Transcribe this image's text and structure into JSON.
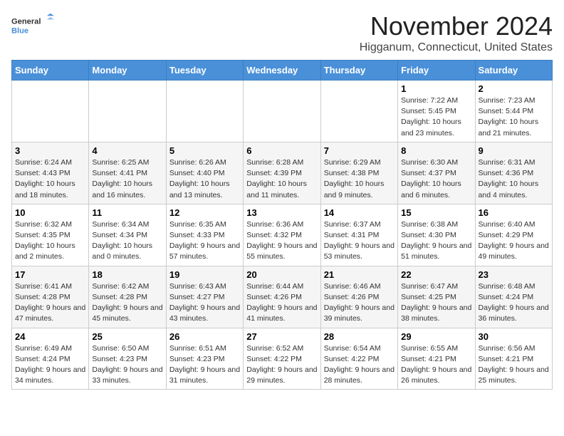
{
  "logo": {
    "line1": "General",
    "line2": "Blue"
  },
  "title": "November 2024",
  "location": "Higganum, Connecticut, United States",
  "weekdays": [
    "Sunday",
    "Monday",
    "Tuesday",
    "Wednesday",
    "Thursday",
    "Friday",
    "Saturday"
  ],
  "weeks": [
    [
      {
        "day": "",
        "info": ""
      },
      {
        "day": "",
        "info": ""
      },
      {
        "day": "",
        "info": ""
      },
      {
        "day": "",
        "info": ""
      },
      {
        "day": "",
        "info": ""
      },
      {
        "day": "1",
        "info": "Sunrise: 7:22 AM\nSunset: 5:45 PM\nDaylight: 10 hours and 23 minutes."
      },
      {
        "day": "2",
        "info": "Sunrise: 7:23 AM\nSunset: 5:44 PM\nDaylight: 10 hours and 21 minutes."
      }
    ],
    [
      {
        "day": "3",
        "info": "Sunrise: 6:24 AM\nSunset: 4:43 PM\nDaylight: 10 hours and 18 minutes."
      },
      {
        "day": "4",
        "info": "Sunrise: 6:25 AM\nSunset: 4:41 PM\nDaylight: 10 hours and 16 minutes."
      },
      {
        "day": "5",
        "info": "Sunrise: 6:26 AM\nSunset: 4:40 PM\nDaylight: 10 hours and 13 minutes."
      },
      {
        "day": "6",
        "info": "Sunrise: 6:28 AM\nSunset: 4:39 PM\nDaylight: 10 hours and 11 minutes."
      },
      {
        "day": "7",
        "info": "Sunrise: 6:29 AM\nSunset: 4:38 PM\nDaylight: 10 hours and 9 minutes."
      },
      {
        "day": "8",
        "info": "Sunrise: 6:30 AM\nSunset: 4:37 PM\nDaylight: 10 hours and 6 minutes."
      },
      {
        "day": "9",
        "info": "Sunrise: 6:31 AM\nSunset: 4:36 PM\nDaylight: 10 hours and 4 minutes."
      }
    ],
    [
      {
        "day": "10",
        "info": "Sunrise: 6:32 AM\nSunset: 4:35 PM\nDaylight: 10 hours and 2 minutes."
      },
      {
        "day": "11",
        "info": "Sunrise: 6:34 AM\nSunset: 4:34 PM\nDaylight: 10 hours and 0 minutes."
      },
      {
        "day": "12",
        "info": "Sunrise: 6:35 AM\nSunset: 4:33 PM\nDaylight: 9 hours and 57 minutes."
      },
      {
        "day": "13",
        "info": "Sunrise: 6:36 AM\nSunset: 4:32 PM\nDaylight: 9 hours and 55 minutes."
      },
      {
        "day": "14",
        "info": "Sunrise: 6:37 AM\nSunset: 4:31 PM\nDaylight: 9 hours and 53 minutes."
      },
      {
        "day": "15",
        "info": "Sunrise: 6:38 AM\nSunset: 4:30 PM\nDaylight: 9 hours and 51 minutes."
      },
      {
        "day": "16",
        "info": "Sunrise: 6:40 AM\nSunset: 4:29 PM\nDaylight: 9 hours and 49 minutes."
      }
    ],
    [
      {
        "day": "17",
        "info": "Sunrise: 6:41 AM\nSunset: 4:28 PM\nDaylight: 9 hours and 47 minutes."
      },
      {
        "day": "18",
        "info": "Sunrise: 6:42 AM\nSunset: 4:28 PM\nDaylight: 9 hours and 45 minutes."
      },
      {
        "day": "19",
        "info": "Sunrise: 6:43 AM\nSunset: 4:27 PM\nDaylight: 9 hours and 43 minutes."
      },
      {
        "day": "20",
        "info": "Sunrise: 6:44 AM\nSunset: 4:26 PM\nDaylight: 9 hours and 41 minutes."
      },
      {
        "day": "21",
        "info": "Sunrise: 6:46 AM\nSunset: 4:26 PM\nDaylight: 9 hours and 39 minutes."
      },
      {
        "day": "22",
        "info": "Sunrise: 6:47 AM\nSunset: 4:25 PM\nDaylight: 9 hours and 38 minutes."
      },
      {
        "day": "23",
        "info": "Sunrise: 6:48 AM\nSunset: 4:24 PM\nDaylight: 9 hours and 36 minutes."
      }
    ],
    [
      {
        "day": "24",
        "info": "Sunrise: 6:49 AM\nSunset: 4:24 PM\nDaylight: 9 hours and 34 minutes."
      },
      {
        "day": "25",
        "info": "Sunrise: 6:50 AM\nSunset: 4:23 PM\nDaylight: 9 hours and 33 minutes."
      },
      {
        "day": "26",
        "info": "Sunrise: 6:51 AM\nSunset: 4:23 PM\nDaylight: 9 hours and 31 minutes."
      },
      {
        "day": "27",
        "info": "Sunrise: 6:52 AM\nSunset: 4:22 PM\nDaylight: 9 hours and 29 minutes."
      },
      {
        "day": "28",
        "info": "Sunrise: 6:54 AM\nSunset: 4:22 PM\nDaylight: 9 hours and 28 minutes."
      },
      {
        "day": "29",
        "info": "Sunrise: 6:55 AM\nSunset: 4:21 PM\nDaylight: 9 hours and 26 minutes."
      },
      {
        "day": "30",
        "info": "Sunrise: 6:56 AM\nSunset: 4:21 PM\nDaylight: 9 hours and 25 minutes."
      }
    ]
  ]
}
